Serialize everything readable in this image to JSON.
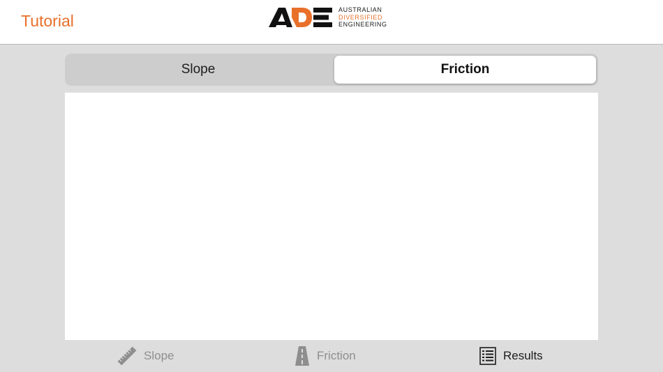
{
  "navbar": {
    "back_label": "Tutorial",
    "logo": {
      "mark": "ADE",
      "line1": "AUSTRALIAN",
      "line2": "DIVERSIFIED",
      "line3": "ENGINEERING"
    }
  },
  "segmented_control": {
    "options": [
      "Slope",
      "Friction"
    ],
    "selected": "Friction"
  },
  "tab_bar": {
    "items": [
      {
        "label": "Slope",
        "icon": "ruler-icon",
        "active": false
      },
      {
        "label": "Friction",
        "icon": "road-icon",
        "active": false
      },
      {
        "label": "Results",
        "icon": "list-icon",
        "active": true
      }
    ]
  },
  "colors": {
    "accent": "#e8702a",
    "background": "#dddddd",
    "inactive_tab": "#8e8e8e"
  }
}
